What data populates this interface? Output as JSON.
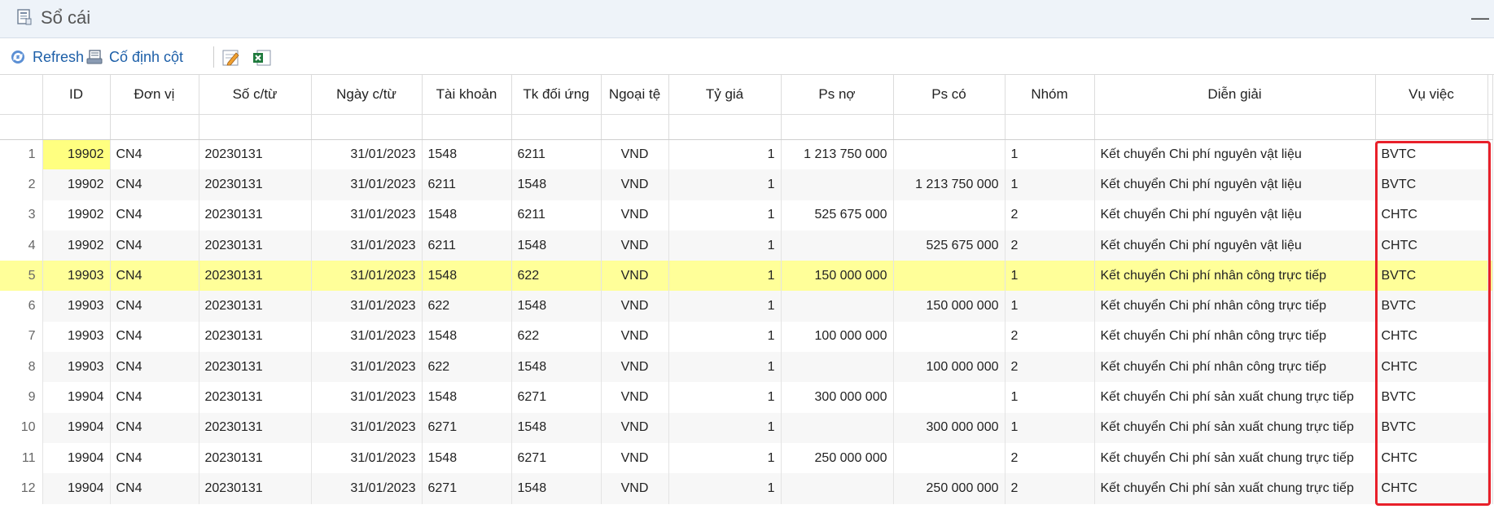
{
  "window": {
    "title": "Sổ cái",
    "minimize_label": "—"
  },
  "toolbar": {
    "refresh_label": "Refresh",
    "freeze_label": "Cố định cột"
  },
  "table": {
    "columns": [
      "ID",
      "Đơn vị",
      "Số c/từ",
      "Ngày c/từ",
      "Tài khoản",
      "Tk đối ứng",
      "Ngoại tệ",
      "Tỷ giá",
      "Ps nợ",
      "Ps có",
      "Nhóm",
      "Diễn giải",
      "Vụ việc"
    ],
    "rows": [
      {
        "n": "1",
        "id": "19902",
        "dv": "CN4",
        "so": "20230131",
        "ngay": "31/01/2023",
        "tk": "1548",
        "tkdu": "6211",
        "nt": "VND",
        "tg": "1",
        "psno": "1 213 750 000",
        "psco": "",
        "nhom": "1",
        "dg": "Kết chuyển Chi phí nguyên vật liệu",
        "vv": "BVTC"
      },
      {
        "n": "2",
        "id": "19902",
        "dv": "CN4",
        "so": "20230131",
        "ngay": "31/01/2023",
        "tk": "6211",
        "tkdu": "1548",
        "nt": "VND",
        "tg": "1",
        "psno": "",
        "psco": "1 213 750 000",
        "nhom": "1",
        "dg": "Kết chuyển Chi phí nguyên vật liệu",
        "vv": "BVTC"
      },
      {
        "n": "3",
        "id": "19902",
        "dv": "CN4",
        "so": "20230131",
        "ngay": "31/01/2023",
        "tk": "1548",
        "tkdu": "6211",
        "nt": "VND",
        "tg": "1",
        "psno": "525 675 000",
        "psco": "",
        "nhom": "2",
        "dg": "Kết chuyển Chi phí nguyên vật liệu",
        "vv": "CHTC"
      },
      {
        "n": "4",
        "id": "19902",
        "dv": "CN4",
        "so": "20230131",
        "ngay": "31/01/2023",
        "tk": "6211",
        "tkdu": "1548",
        "nt": "VND",
        "tg": "1",
        "psno": "",
        "psco": "525 675 000",
        "nhom": "2",
        "dg": "Kết chuyển Chi phí nguyên vật liệu",
        "vv": "CHTC"
      },
      {
        "n": "5",
        "id": "19903",
        "dv": "CN4",
        "so": "20230131",
        "ngay": "31/01/2023",
        "tk": "1548",
        "tkdu": "622",
        "nt": "VND",
        "tg": "1",
        "psno": "150 000 000",
        "psco": "",
        "nhom": "1",
        "dg": "Kết chuyển Chi phí nhân công trực tiếp",
        "vv": "BVTC"
      },
      {
        "n": "6",
        "id": "19903",
        "dv": "CN4",
        "so": "20230131",
        "ngay": "31/01/2023",
        "tk": "622",
        "tkdu": "1548",
        "nt": "VND",
        "tg": "1",
        "psno": "",
        "psco": "150 000 000",
        "nhom": "1",
        "dg": "Kết chuyển Chi phí nhân công trực tiếp",
        "vv": "BVTC"
      },
      {
        "n": "7",
        "id": "19903",
        "dv": "CN4",
        "so": "20230131",
        "ngay": "31/01/2023",
        "tk": "1548",
        "tkdu": "622",
        "nt": "VND",
        "tg": "1",
        "psno": "100 000 000",
        "psco": "",
        "nhom": "2",
        "dg": "Kết chuyển Chi phí nhân công trực tiếp",
        "vv": "CHTC"
      },
      {
        "n": "8",
        "id": "19903",
        "dv": "CN4",
        "so": "20230131",
        "ngay": "31/01/2023",
        "tk": "622",
        "tkdu": "1548",
        "nt": "VND",
        "tg": "1",
        "psno": "",
        "psco": "100 000 000",
        "nhom": "2",
        "dg": "Kết chuyển Chi phí nhân công trực tiếp",
        "vv": "CHTC"
      },
      {
        "n": "9",
        "id": "19904",
        "dv": "CN4",
        "so": "20230131",
        "ngay": "31/01/2023",
        "tk": "1548",
        "tkdu": "6271",
        "nt": "VND",
        "tg": "1",
        "psno": "300 000 000",
        "psco": "",
        "nhom": "1",
        "dg": "Kết chuyển Chi phí sản xuất chung trực tiếp",
        "vv": "BVTC"
      },
      {
        "n": "10",
        "id": "19904",
        "dv": "CN4",
        "so": "20230131",
        "ngay": "31/01/2023",
        "tk": "6271",
        "tkdu": "1548",
        "nt": "VND",
        "tg": "1",
        "psno": "",
        "psco": "300 000 000",
        "nhom": "1",
        "dg": "Kết chuyển Chi phí sản xuất chung trực tiếp",
        "vv": "BVTC"
      },
      {
        "n": "11",
        "id": "19904",
        "dv": "CN4",
        "so": "20230131",
        "ngay": "31/01/2023",
        "tk": "1548",
        "tkdu": "6271",
        "nt": "VND",
        "tg": "1",
        "psno": "250 000 000",
        "psco": "",
        "nhom": "2",
        "dg": "Kết chuyển Chi phí sản xuất chung trực tiếp",
        "vv": "CHTC"
      },
      {
        "n": "12",
        "id": "19904",
        "dv": "CN4",
        "so": "20230131",
        "ngay": "31/01/2023",
        "tk": "6271",
        "tkdu": "1548",
        "nt": "VND",
        "tg": "1",
        "psno": "",
        "psco": "250 000 000",
        "nhom": "2",
        "dg": "Kết chuyển Chi phí sản xuất chung trực tiếp",
        "vv": "CHTC"
      }
    ],
    "highlighted_row": 5,
    "selected_id_cell_row": 1
  },
  "colors": {
    "highlight": "#ffff99",
    "link": "#1d5fa8",
    "annotation_box": "#e8202a"
  },
  "icons": [
    "ledger-icon",
    "refresh-icon",
    "freeze-columns-icon",
    "edit-icon",
    "excel-icon"
  ]
}
